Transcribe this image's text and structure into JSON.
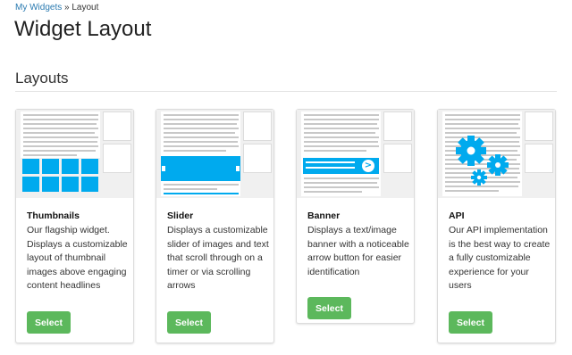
{
  "breadcrumb": {
    "parent": "My Widgets",
    "separator": " » ",
    "current": "Layout"
  },
  "page_title": "Widget Layout",
  "section_title": "Layouts",
  "colors": {
    "accent_blue": "#00aaee",
    "select_green": "#5cb85c",
    "link": "#2a7ab0"
  },
  "cards": [
    {
      "title": "Thumbnails",
      "description": "Our flagship widget. Displays a customizable layout of thumbnail images above engaging content headlines",
      "button_label": "Select",
      "preview_icon": "thumbnail-grid-icon"
    },
    {
      "title": "Slider",
      "description": "Displays a customizable slider of images and text that scroll through on a timer or via scrolling arrows",
      "button_label": "Select",
      "preview_icon": "slider-icon"
    },
    {
      "title": "Banner",
      "description": "Displays a text/image banner with a noticeable arrow button for easier identification",
      "button_label": "Select",
      "preview_icon": "banner-arrow-icon"
    },
    {
      "title": "API",
      "description": "Our API implementation is the best way to create a fully customizable experience for your users",
      "button_label": "Select",
      "preview_icon": "gears-icon"
    }
  ]
}
